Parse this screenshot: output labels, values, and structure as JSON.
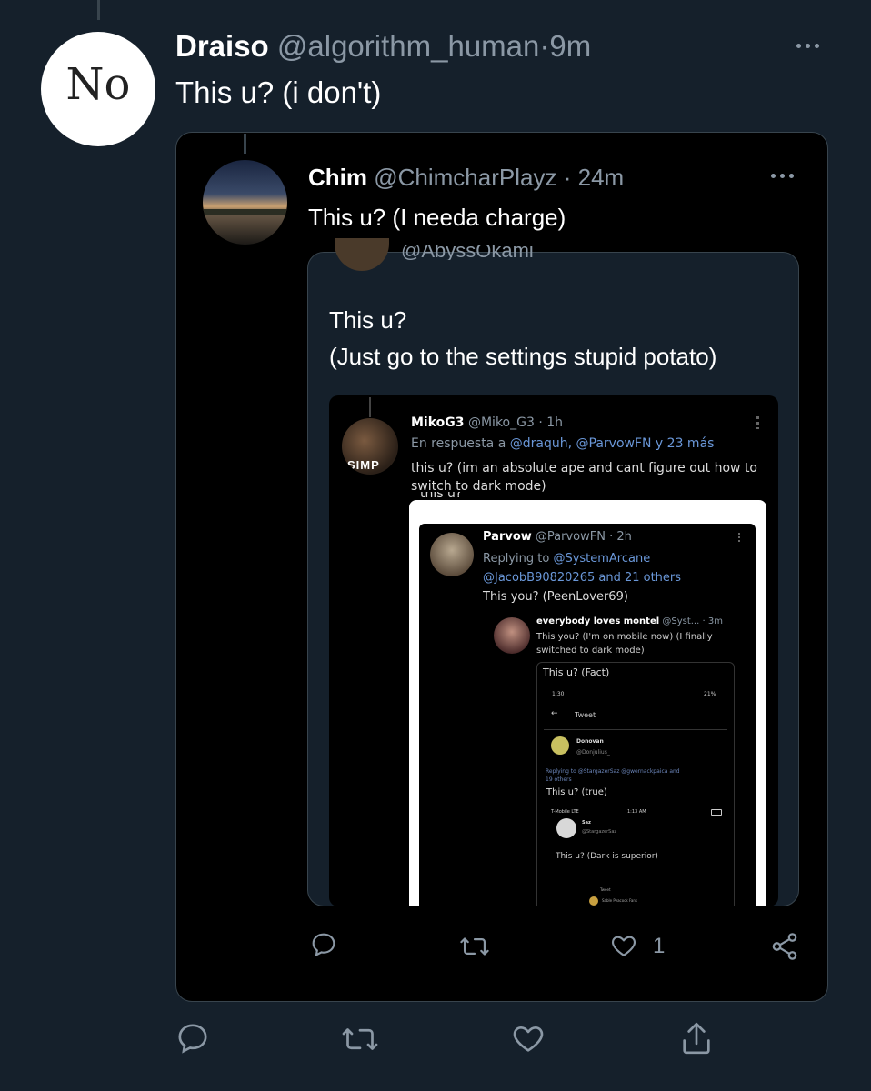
{
  "outer_tweet": {
    "name": "Draiso",
    "handle": "@algorithm_human",
    "sep": "·",
    "time": "9m",
    "text": "This u? (i don't)",
    "avatar_text": "No"
  },
  "quote1": {
    "name": "Chim",
    "handle": "@ChimcharPlayz",
    "sep": "·",
    "time": "24m",
    "text": "This u? (I needa charge)",
    "like_count": "1"
  },
  "quote2": {
    "cut_handle": "@AbyssOkami",
    "line1": "This u?",
    "line2": "(Just go to the settings stupid potato)"
  },
  "quote3": {
    "name": "MikoG3",
    "handle": "@Miko_G3",
    "sep": "·",
    "time": "1h",
    "reply_prefix": "En respuesta a",
    "reply_mentions": "@draquh, @ParvowFN y 23 más",
    "text_line1": "this u? (im an absolute ape and cant figure out how to",
    "text_line2": "switch to dark mode)",
    "avatar_text": "SIMP",
    "cut_text": "this u?"
  },
  "quote4": {
    "name": "Parvow",
    "handle": "@ParvowFN",
    "sep": "·",
    "time": "2h",
    "reply_prefix": "Replying to",
    "mention1": "@SystemArcane",
    "mention2": "@JacobB90820265 and 21 others",
    "text": "This you? (PeenLover69)"
  },
  "quote5": {
    "name": "everybody loves montel",
    "handle": "@Syst...",
    "sep": "·",
    "time": "3m",
    "text_line1": "This you? (I'm on mobile now) (I finally",
    "text_line2": "switched to dark mode)"
  },
  "quote6": {
    "header": "This u? (Fact)",
    "status_time": "1:30",
    "status_right": "21%",
    "nav_title": "Tweet",
    "name": "Donovan",
    "handle": "@Donjulius_",
    "reply_line1": "Replying to @StargazerSaz @gwernackpaica and",
    "reply_line2": "19 others",
    "text": "This u? (true)"
  },
  "quote7": {
    "carrier": "T-Mobile LTE",
    "status_time": "1:13 AM",
    "name": "Saz",
    "handle": "@StargazerSaz",
    "text": "This u? (Dark is superior)"
  },
  "quote8": {
    "name": "Sable Peacock Fans",
    "nav_title": "Tweet"
  },
  "icons": [
    "reply-icon",
    "retweet-icon",
    "like-icon",
    "share-icon",
    "more-icon"
  ],
  "colors": {
    "background": "#15202b",
    "quote_bg": "#000000",
    "link": "#1d9bf0",
    "muted": "#8b98a5"
  }
}
